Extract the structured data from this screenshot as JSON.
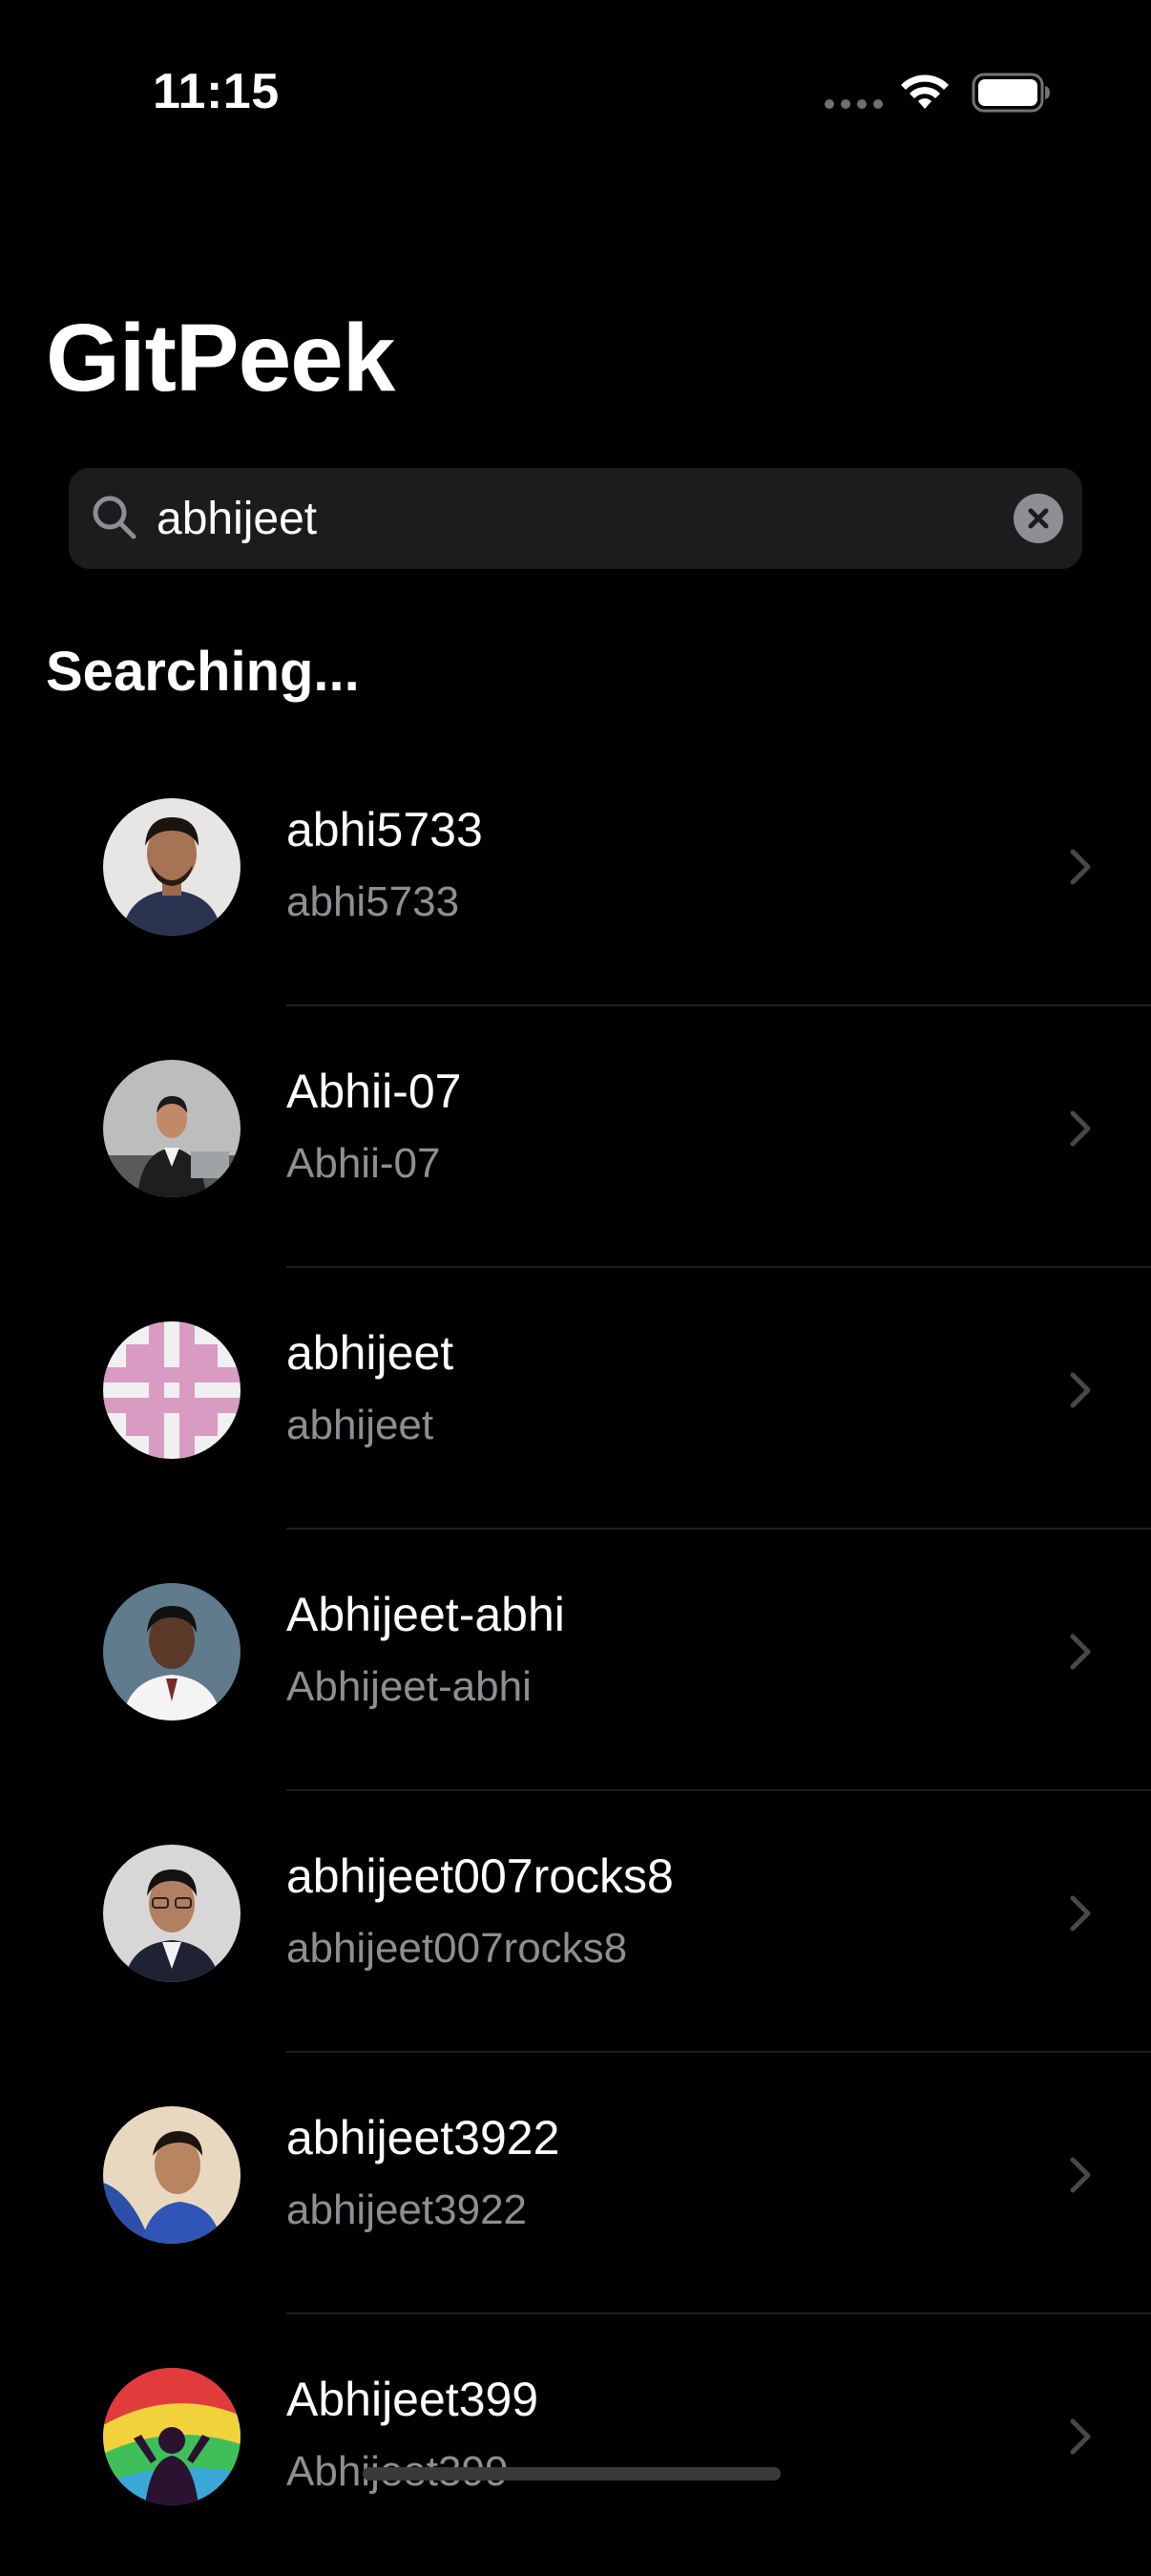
{
  "status_bar": {
    "time": "11:15",
    "wifi_icon": "wifi-icon",
    "battery_icon": "battery-icon"
  },
  "app": {
    "title": "GitPeek"
  },
  "search": {
    "value": "abhijeet",
    "search_icon": "magnifying-glass",
    "clear_icon": "xmark-circle"
  },
  "results": {
    "status": "Searching...",
    "users": [
      {
        "name": "abhi5733",
        "login": "abhi5733"
      },
      {
        "name": "Abhii-07",
        "login": "Abhii-07"
      },
      {
        "name": "abhijeet",
        "login": "abhijeet"
      },
      {
        "name": "Abhijeet-abhi",
        "login": "Abhijeet-abhi"
      },
      {
        "name": "abhijeet007rocks8",
        "login": "abhijeet007rocks8"
      },
      {
        "name": "abhijeet3922",
        "login": "abhijeet3922"
      },
      {
        "name": "Abhijeet399",
        "login": "Abhijeet399"
      }
    ]
  },
  "colors": {
    "background": "#000000",
    "search_field": "#1c1c1e",
    "secondary_text": "#8e8e93",
    "chevron": "#48484a"
  }
}
